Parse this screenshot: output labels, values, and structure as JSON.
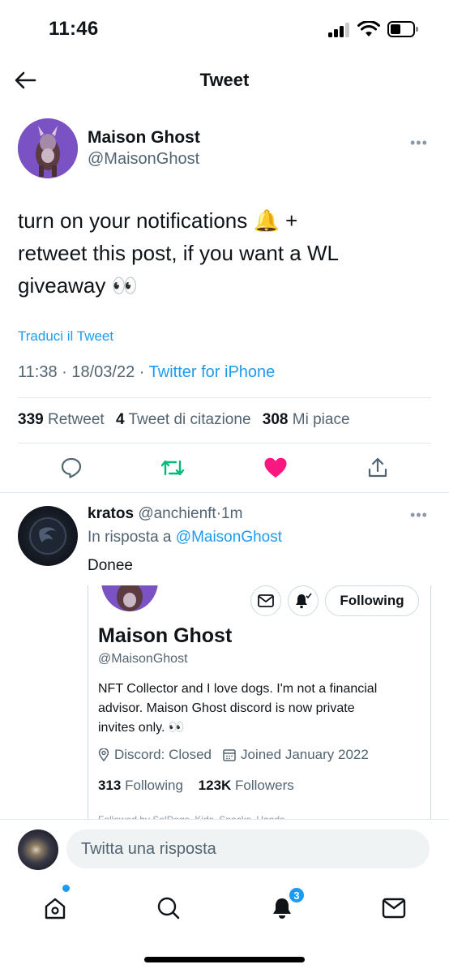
{
  "status_bar": {
    "time": "11:46"
  },
  "header": {
    "title": "Tweet"
  },
  "tweet": {
    "author_name": "Maison Ghost",
    "author_handle": "@MaisonGhost",
    "text_line1": "turn on your notifications 🔔 +",
    "text_line2": "retweet this post, if you want a WL",
    "text_line3": "giveaway 👀",
    "translate": "Traduci il Tweet",
    "time": "11:38",
    "date": "18/03/22",
    "source": "Twitter for iPhone",
    "separator": "·"
  },
  "stats": {
    "retweets_count": "339",
    "retweets_label": "Retweet",
    "quotes_count": "4",
    "quotes_label": "Tweet di citazione",
    "likes_count": "308",
    "likes_label": "Mi piace"
  },
  "actions": {
    "liked": true,
    "like_color": "#f91880",
    "retweet_color": "#00ba7c"
  },
  "reply": {
    "name": "kratos",
    "handle": "@anchienft",
    "time": "1m",
    "in_reply_label": "In risposta a",
    "in_reply_handle": "@MaisonGhost",
    "text": "Donee"
  },
  "profile_card": {
    "following_button": "Following",
    "name": "Maison Ghost",
    "handle": "@MaisonGhost",
    "bio_line1": "NFT Collector and I love dogs. I'm not a financial",
    "bio_line2": "advisor. Maison Ghost discord is now private",
    "bio_line3": "invites only. 👀",
    "location": "Discord: Closed",
    "joined": "Joined January 2022",
    "following_count": "313",
    "following_label": "Following",
    "followers_count": "123K",
    "followers_label": "Followers",
    "followed_by": "Followed by SolDogs, Kids, Snacks, Hands"
  },
  "compose": {
    "placeholder": "Twitta una risposta"
  },
  "tabbar": {
    "notifications_badge": "3"
  },
  "colors": {
    "accent": "#1d9bf0",
    "text": "#0f1419",
    "secondary": "#536471"
  }
}
